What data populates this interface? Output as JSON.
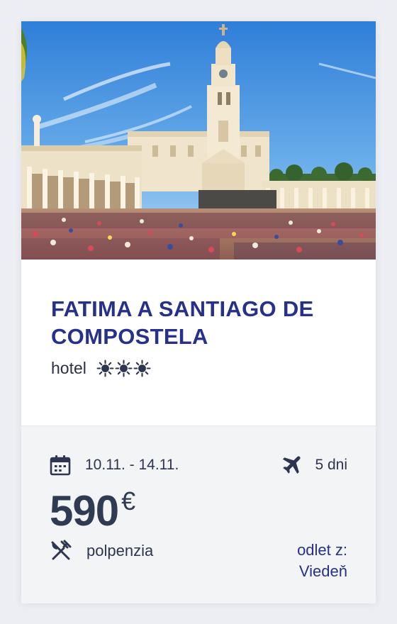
{
  "offer": {
    "image_alt": "Sanctuary of Fatima with crowd of pilgrims",
    "title": "FATIMA A SANTIAGO DE COMPOSTELA",
    "accommodation": "hotel",
    "stars": 3,
    "star_icon": "sun-icon",
    "dates": "10.11. - 14.11.",
    "duration": "5 dni",
    "price": "590",
    "currency": "€",
    "board": "polpenzia",
    "departure_label": "odlet z:",
    "departure_city": "Viedeň"
  },
  "colors": {
    "title": "#27318a",
    "text": "#2d3550",
    "price": "#2e3b52",
    "page_background": "#eceef3",
    "footer_background": "#f3f4f6"
  }
}
